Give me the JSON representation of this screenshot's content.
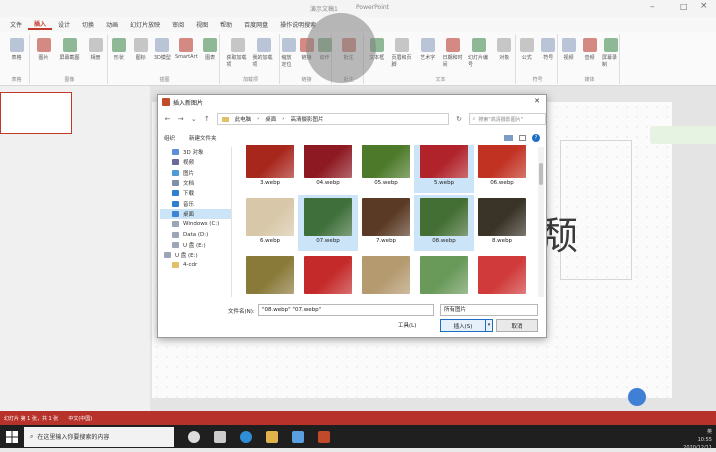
{
  "window": {
    "title": "PowerPoint",
    "doc_title": "演示文稿1"
  },
  "tabs": [
    "文件",
    "插入",
    "设计",
    "切换",
    "动画",
    "幻灯片放映",
    "审阅",
    "视图",
    "帮助",
    "百度网盘",
    "操作说明搜索"
  ],
  "active_tab_index": 1,
  "ribbon": {
    "groups": [
      {
        "label": "表格",
        "buttons": [
          "表格"
        ]
      },
      {
        "label": "图像",
        "buttons": [
          "图片",
          "屏幕截图",
          "相册"
        ]
      },
      {
        "label": "插图",
        "buttons": [
          "形状",
          "图标",
          "3D模型",
          "SmartArt",
          "图表"
        ]
      },
      {
        "label": "加载项",
        "buttons": [
          "获取加载项",
          "我的加载项"
        ]
      },
      {
        "label": "链接",
        "buttons": [
          "缩放定位",
          "链接",
          "动作"
        ]
      },
      {
        "label": "批注",
        "buttons": [
          "批注"
        ]
      },
      {
        "label": "文本",
        "buttons": [
          "文本框",
          "页眉和页脚",
          "艺术字",
          "日期和时间",
          "幻灯片编号",
          "对象"
        ]
      },
      {
        "label": "符号",
        "buttons": [
          "公式",
          "符号"
        ]
      },
      {
        "label": "媒体",
        "buttons": [
          "视频",
          "音频",
          "屏幕录制"
        ]
      }
    ]
  },
  "slide": {
    "char": "颓"
  },
  "dialog": {
    "title": "插入新图片",
    "breadcrumb": [
      "此电脑",
      "桌面",
      "高清摄影图片"
    ],
    "search_placeholder": "搜索\"高清摄影图片\"",
    "organize_label": "组织",
    "new_folder_label": "新建文件夹",
    "nav_items": [
      {
        "label": "3D 对象",
        "color": "#5b8fd6"
      },
      {
        "label": "视频",
        "color": "#6a6a9a"
      },
      {
        "label": "图片",
        "color": "#4d9ad6"
      },
      {
        "label": "文档",
        "color": "#7f8fa6"
      },
      {
        "label": "下载",
        "color": "#2f7fd0"
      },
      {
        "label": "音乐",
        "color": "#2f7fd0"
      },
      {
        "label": "桌面",
        "color": "#3a85d6",
        "selected": true
      },
      {
        "label": "Windows (C:)",
        "color": "#9aa6b5"
      },
      {
        "label": "Data (D:)",
        "color": "#9aa6b5"
      },
      {
        "label": "U 盘 (E:)",
        "color": "#9aa6b5"
      },
      {
        "label": "U 盘 (E:)",
        "color": "#9aa6b5",
        "sub": true
      },
      {
        "label": "4-cdr",
        "color": "#e2c06a"
      }
    ],
    "files": [
      {
        "name": "3.webp",
        "color": "#a8271d",
        "selected": false
      },
      {
        "name": "04.webp",
        "color": "#8d1a22",
        "selected": false
      },
      {
        "name": "05.webp",
        "color": "#4d7a2a",
        "selected": false
      },
      {
        "name": "5.webp",
        "color": "#b0232a",
        "selected": true
      },
      {
        "name": "06.webp",
        "color": "#c13223",
        "selected": false
      },
      {
        "name": "6.webp",
        "color": "#d8c8a9",
        "selected": false
      },
      {
        "name": "07.webp",
        "color": "#3f6f3a",
        "selected": true
      },
      {
        "name": "7.webp",
        "color": "#5a3a24",
        "selected": false
      },
      {
        "name": "08.webp",
        "color": "#446f34",
        "selected": true
      },
      {
        "name": "8.webp",
        "color": "#3a3428",
        "selected": false
      },
      {
        "name": "",
        "color": "#8a7a3a",
        "selected": false
      },
      {
        "name": "",
        "color": "#c42a2a",
        "selected": false
      },
      {
        "name": "",
        "color": "#b59a70",
        "selected": false
      },
      {
        "name": "",
        "color": "#6a9a5a",
        "selected": false
      },
      {
        "name": "",
        "color": "#d03a3a",
        "selected": false
      }
    ],
    "filename_label": "文件名(N):",
    "filename_value": "\"08.webp\" \"07.webp\"",
    "filetype_value": "所有图片",
    "tools_label": "工具(L)",
    "insert_label": "插入(S)",
    "cancel_label": "取消"
  },
  "statusbar": {
    "slide_info": "幻灯片 第 1 张，共 1 张",
    "language": "中文(中国)"
  },
  "taskbar": {
    "search_placeholder": "在这里输入你要搜索的内容",
    "time": "10:55",
    "date": "2020/12/11",
    "ime": "英"
  }
}
